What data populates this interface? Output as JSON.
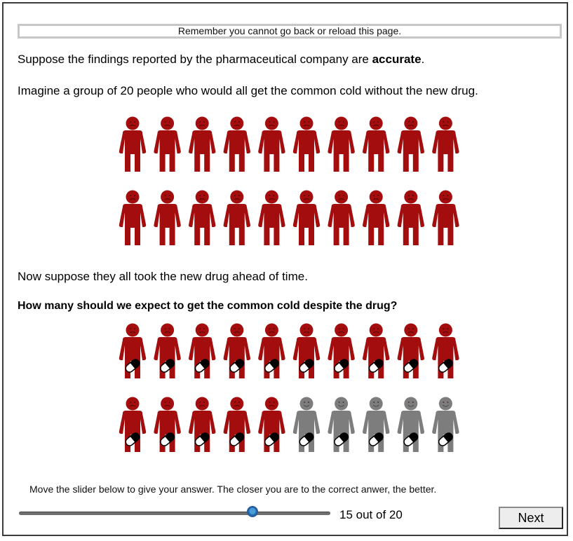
{
  "banner_text": "Remember you cannot go back or reload this page.",
  "intro": {
    "prefix": "Suppose the findings reported by the pharmaceutical company are ",
    "emphasis": "accurate",
    "suffix": "."
  },
  "imagine_text": "Imagine a group of 20 people who would all get the common cold without the new drug.",
  "suppose_text": "Now suppose they all took the new drug ahead of time.",
  "question_text": "How many should we expect to get the common cold despite the drug?",
  "icon_array_before": {
    "total": 20,
    "sick": 20,
    "with_pill": false
  },
  "icon_array_after": {
    "total": 20,
    "sick": 15,
    "with_pill": true
  },
  "colors": {
    "sick": "#a30d0d",
    "healthy": "#7d7d7d"
  },
  "slider": {
    "hint": "Move the slider below to give your answer. The closer you are to the correct anwer, the better.",
    "value": 15,
    "max": 20,
    "readout": "15 out of 20"
  },
  "next_label": "Next"
}
